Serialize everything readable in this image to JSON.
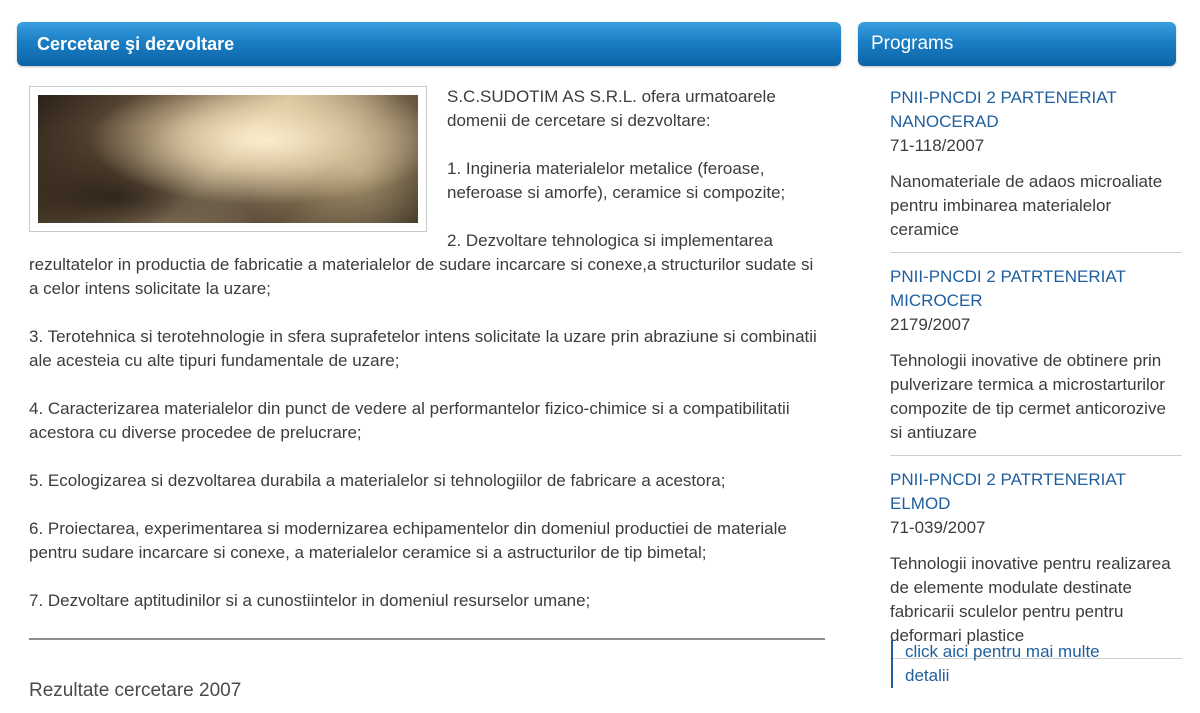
{
  "header_main": {
    "title": "Cercetare şi dezvoltare"
  },
  "header_side": {
    "title": "Programs"
  },
  "intro": "S.C.SUDOTIM AS S.R.L. ofera urmatoarele domenii de cercetare si dezvoltare:",
  "items": [
    "1. Ingineria materialelor metalice (feroase, neferoase si amorfe), ceramice si compozite;",
    "2. Dezvoltare tehnologica si implementarea rezultatelor in productia de fabricatie a materialelor de sudare incarcare si conexe,a structurilor sudate si a celor intens solicitate la uzare;",
    "3. Terotehnica si terotehnologie in sfera suprafetelor intens solicitate la uzare prin abraziune si combinatii ale acesteia cu alte tipuri fundamentale de uzare;",
    "4. Caracterizarea materialelor din punct de vedere al performantelor fizico-chimice si a compatibilitatii acestora cu diverse procedee de prelucrare;",
    "5. Ecologizarea si dezvoltarea durabila a materialelor si tehnologiilor de fabricare a acestora;",
    "6. Proiectarea, experimentarea si modernizarea echipamentelor din domeniul productiei de materiale pentru sudare incarcare si conexe, a materialelor ceramice si a astructurilor de tip bimetal;",
    "7. Dezvoltare aptitudinilor si a cunostiintelor in domeniul resurselor umane;"
  ],
  "results_title": "Rezultate cercetare 2007",
  "programs": [
    {
      "title": "PNII-PNCDI 2 PARTENERIAT NANOCERAD",
      "code": "71-118/2007",
      "description": "Nanomateriale de adaos microaliate pentru imbinarea materialelor ceramice"
    },
    {
      "title": "PNII-PNCDI 2 PATRTENERIAT MICROCER",
      "code": "2179/2007",
      "description": "Tehnologii inovative de obtinere prin pulverizare termica a microstarturilor compozite de tip cermet anticorozive si antiuzare"
    },
    {
      "title": "PNII-PNCDI 2 PATRTENERIAT ELMOD",
      "code": "71-039/2007",
      "description": "Tehnologii inovative pentru realizarea de elemente modulate destinate fabricarii sculelor pentru pentru deformari plastice"
    }
  ],
  "more_link": "click aici pentru mai multe detalii",
  "colors": {
    "header_blue": "#1a7ec4",
    "link_blue": "#1f5f9e",
    "text_gray": "#3c3c3c"
  }
}
